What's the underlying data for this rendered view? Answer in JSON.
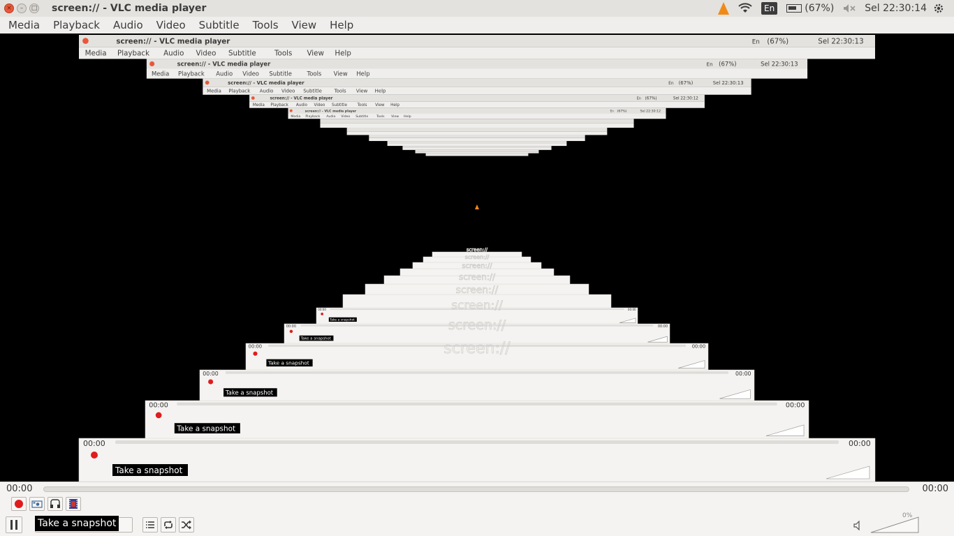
{
  "window": {
    "title": "screen:// - VLC media player",
    "buttons": {
      "close": "×",
      "minimize": "–",
      "maximize": "□"
    }
  },
  "indicators": {
    "vlc_icon": "vlc-cone-icon",
    "wifi_icon": "wifi-icon",
    "language": "En",
    "battery": "(67%)",
    "volume_icon": "speaker-muted-icon",
    "clock": "Sel 22:30:14",
    "settings_icon": "gear-icon"
  },
  "menu": [
    "Media",
    "Playback",
    "Audio",
    "Video",
    "Subtitle",
    "Tools",
    "View",
    "Help"
  ],
  "nested_frames": [
    {
      "title": "screen:// - VLC media player",
      "clock": "Sel 22:30:13",
      "battery": "(67%)",
      "lang": "En",
      "menu": [
        "Media",
        "Playback",
        "Audio",
        "Video",
        "Subtitle",
        "Tools",
        "View",
        "Help"
      ]
    },
    {
      "title": "screen:// - VLC media player",
      "clock": "Sel 22:30:13",
      "battery": "(67%)",
      "lang": "En",
      "menu": [
        "Media",
        "Playback",
        "Audio",
        "Video",
        "Subtitle",
        "Tools",
        "View",
        "Help"
      ]
    },
    {
      "title": "screen:// - VLC media player",
      "clock": "Sel 22:30:13",
      "battery": "(67%)",
      "lang": "En",
      "menu": [
        "Media",
        "Playback",
        "Audio",
        "Video",
        "Subtitle",
        "Tools",
        "View",
        "Help"
      ]
    },
    {
      "title": "screen:// - VLC media player",
      "clock": "Sel 22:30:12",
      "battery": "(67%)",
      "lang": "En",
      "menu": [
        "Media",
        "Playback",
        "Audio",
        "Video",
        "Subtitle",
        "Tools",
        "View",
        "Help"
      ]
    },
    {
      "title": "screen:// - VLC media player",
      "clock": "Sel 22:30:12",
      "battery": "(67%)",
      "lang": "En",
      "menu": [
        "Media",
        "Playback",
        "Audio",
        "Video",
        "Subtitle",
        "Tools",
        "View",
        "Help"
      ]
    }
  ],
  "ghost_text": "screen://",
  "controls": {
    "elapsed": "00:00",
    "total": "00:00",
    "tooltip": "Take a snapshot",
    "volume_label": "0%",
    "icons": {
      "record": "record-icon",
      "snapshot": "camera-icon",
      "loop_ab": "loop-ab-icon",
      "frame_by_frame": "frame-step-icon",
      "pause": "pause-icon",
      "playlist": "playlist-icon",
      "loop": "loop-icon",
      "shuffle": "shuffle-icon",
      "volume": "speaker-icon"
    }
  }
}
